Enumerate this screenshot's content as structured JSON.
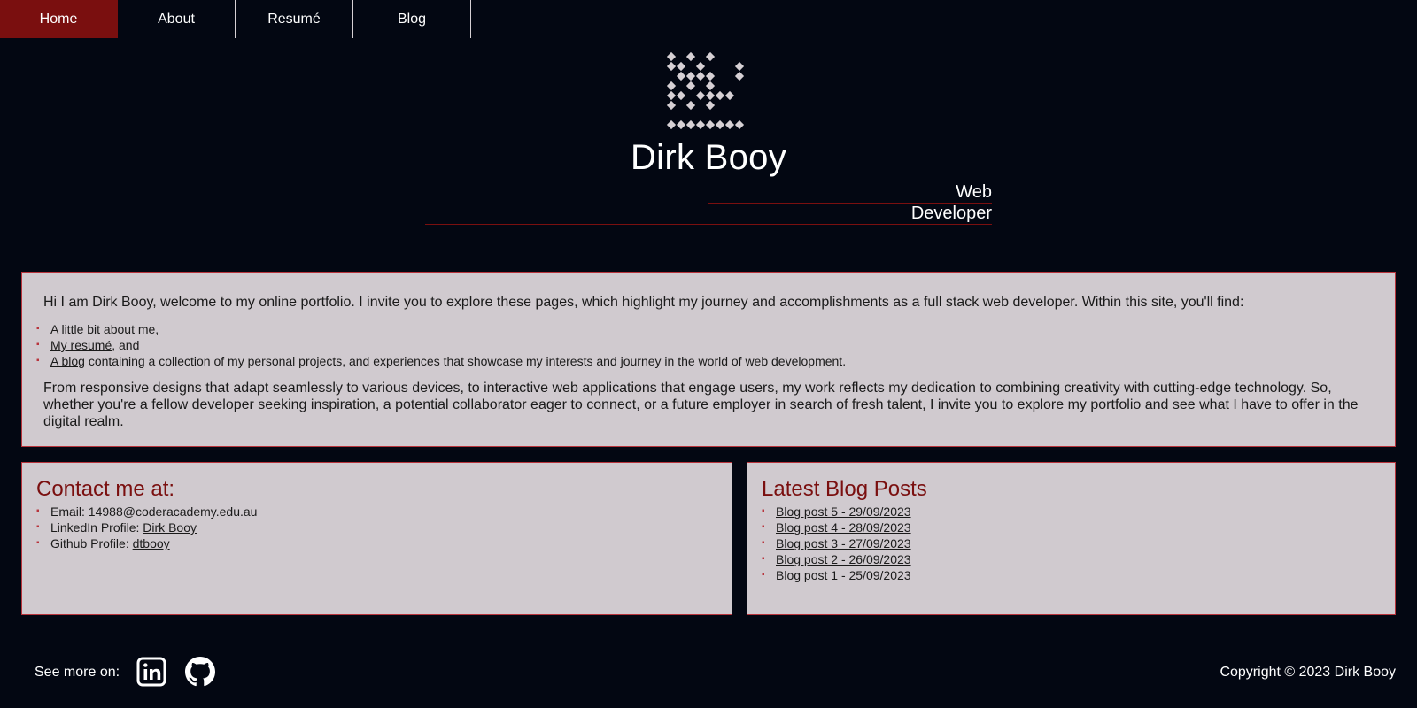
{
  "nav": {
    "items": [
      {
        "label": "Home",
        "active": true
      },
      {
        "label": "About",
        "active": false
      },
      {
        "label": "Resumé",
        "active": false
      },
      {
        "label": "Blog",
        "active": false
      }
    ]
  },
  "header": {
    "logo_icon": "db-monogram-logo-icon",
    "name": "Dirk Booy",
    "role_line1": "Web",
    "role_line2": "Developer"
  },
  "intro": {
    "text1": "Hi I am Dirk Booy, welcome to my online portfolio. I invite you to explore these pages, which highlight my journey and accomplishments as a full stack web developer. Within this site, you'll find:",
    "list": [
      {
        "prefix": "A little bit ",
        "link": "about me",
        "suffix": ","
      },
      {
        "prefix": "",
        "link": "My resumé",
        "suffix": ", and"
      },
      {
        "prefix": "",
        "link": "A blog",
        "suffix": " containing a collection of my personal projects, and experiences that showcase my interests and journey in the world of web development."
      }
    ],
    "text2": "From responsive designs that adapt seamlessly to various devices, to interactive web applications that engage users, my work reflects my dedication to combining creativity with cutting-edge technology. So, whether you're a fellow developer seeking inspiration, a potential collaborator eager to connect, or a future employer in search of fresh talent, I invite you to explore my portfolio and see what I have to offer in the digital realm."
  },
  "contact": {
    "title": "Contact me at:",
    "email_label": "Email: ",
    "email": "14988@coderacademy.edu.au",
    "linkedin_label": "LinkedIn Profile: ",
    "linkedin_link": "Dirk Booy",
    "github_label": "Github Profile: ",
    "github_link": "dtbooy"
  },
  "blog": {
    "title": "Latest Blog Posts",
    "posts": [
      "Blog post 5 - 29/09/2023",
      "Blog post 4 - 28/09/2023",
      "Blog post 3 - 27/09/2023",
      "Blog post 2 - 26/09/2023",
      "Blog post 1 - 25/09/2023"
    ]
  },
  "footer": {
    "see_more": "See more on:",
    "icons": [
      "linkedin-icon",
      "github-icon"
    ],
    "copyright": "Copyright © 2023 Dirk Booy"
  },
  "colors": {
    "background": "#030712",
    "accent": "#7a0f0f",
    "panel": "#d0cacf",
    "panel_border": "#b8343c"
  }
}
